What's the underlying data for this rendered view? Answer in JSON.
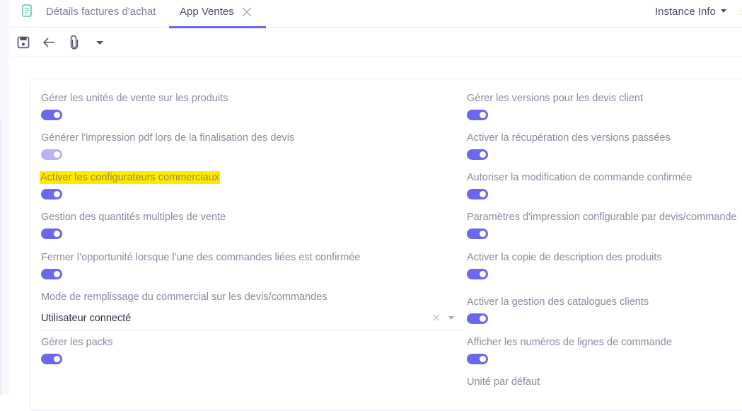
{
  "tabs": [
    {
      "label": "Détails factures d'achat",
      "icon": "document-icon",
      "active": false
    },
    {
      "label": "App Ventes",
      "active": true,
      "closable": true
    }
  ],
  "header": {
    "instance_info_label": "Instance Info"
  },
  "toolbar": {
    "items": [
      "save-icon",
      "back-arrow-icon",
      "paperclip-icon",
      "caret-down-icon"
    ]
  },
  "colors": {
    "accent": "#6b67ef",
    "accent_disabled": "#b6b4f5",
    "highlight": "#ffe900",
    "tab_underline": "#6d6ae8"
  },
  "left_column": {
    "fields": [
      {
        "label": "Gérer les unités de vente sur les produits",
        "type": "toggle",
        "value": true
      },
      {
        "label": "Générer l'impression pdf lors de la finalisation des devis",
        "type": "toggle",
        "value": true,
        "disabled": true
      },
      {
        "label": "Activer les configurateurs commerciaux",
        "type": "toggle",
        "value": true,
        "highlighted": true
      },
      {
        "label": "Gestion des quantités multiples de vente",
        "type": "toggle",
        "value": true
      },
      {
        "label": "Fermer l’opportunité lorsque l’une des commandes liées est confirmée",
        "type": "toggle",
        "value": true
      },
      {
        "label": "Mode de remplissage du commercial sur les devis/commandes",
        "type": "select",
        "value": "Utilisateur connecté"
      },
      {
        "label": "Gérer les packs",
        "type": "toggle",
        "value": true
      }
    ]
  },
  "right_column": {
    "fields": [
      {
        "label": "Gérer les versions pour les devis client",
        "type": "toggle",
        "value": true
      },
      {
        "label": "Activer la récupération des versions passées",
        "type": "toggle",
        "value": true
      },
      {
        "label": "Autoriser la modification de commande confirmée",
        "type": "toggle",
        "value": true
      },
      {
        "label": "Paramètres d'impression configurable par devis/commande",
        "type": "toggle",
        "value": true
      },
      {
        "label": "Activer la copie de description des produits",
        "type": "toggle",
        "value": true
      },
      {
        "label": "Activer la gestion des catalogues clients",
        "type": "toggle",
        "value": true
      },
      {
        "label": "Afficher les numéros de lignes de commande",
        "type": "toggle",
        "value": true
      },
      {
        "label": "Unité par défaut",
        "type": "label"
      }
    ]
  }
}
